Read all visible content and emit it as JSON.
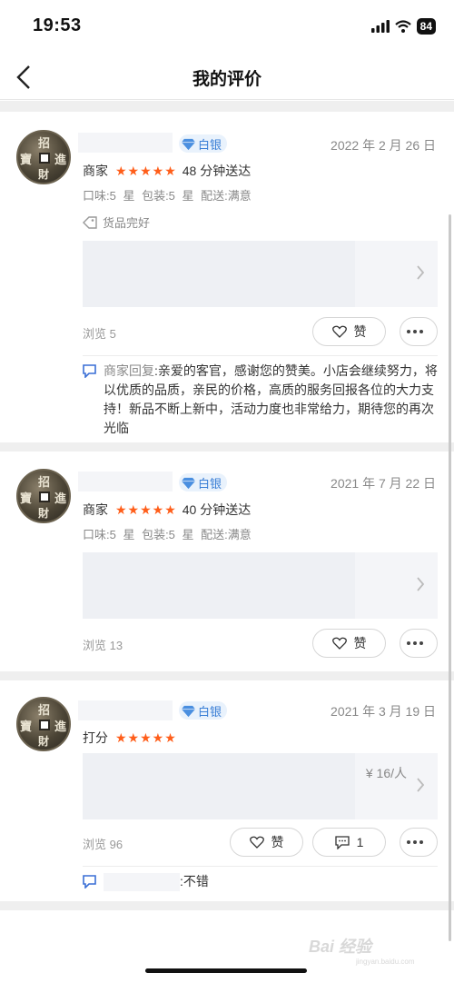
{
  "status_bar": {
    "time": "19:53",
    "battery": "84"
  },
  "nav": {
    "title": "我的评价"
  },
  "reviews": [
    {
      "badge": "白银",
      "date": "2022 年 2 月 26 日",
      "rating_label": "商家",
      "stars": "★★★★★",
      "delivery": "48 分钟送达",
      "sub_scores": "口味:5 星  包装:5 星  配送:满意",
      "tag": "货品完好",
      "views": "浏览 5",
      "like_label": "赞",
      "reply_label": "商家回复",
      "reply_text": ":亲爱的客官，感谢您的赞美。小店会继续努力，将以优质的品质，亲民的价格，高质的服务回报各位的大力支持！新品不断上新中，活动力度也非常给力，期待您的再次光临"
    },
    {
      "badge": "白银",
      "date": "2021 年 7 月 22 日",
      "rating_label": "商家",
      "stars": "★★★★★",
      "delivery": "40 分钟送达",
      "sub_scores": "口味:5 星  包装:5 星  配送:满意",
      "views": "浏览 13",
      "like_label": "赞"
    },
    {
      "badge": "白银",
      "date": "2021 年 3 月 19 日",
      "rating_label": "打分",
      "stars": "★★★★★",
      "price": "¥ 16/人",
      "views": "浏览 96",
      "like_label": "赞",
      "comment_count": "1",
      "reply_text": ":不错"
    }
  ],
  "watermark": {
    "main": "Bai 经验",
    "sub": "jingyan.baidu.com"
  }
}
